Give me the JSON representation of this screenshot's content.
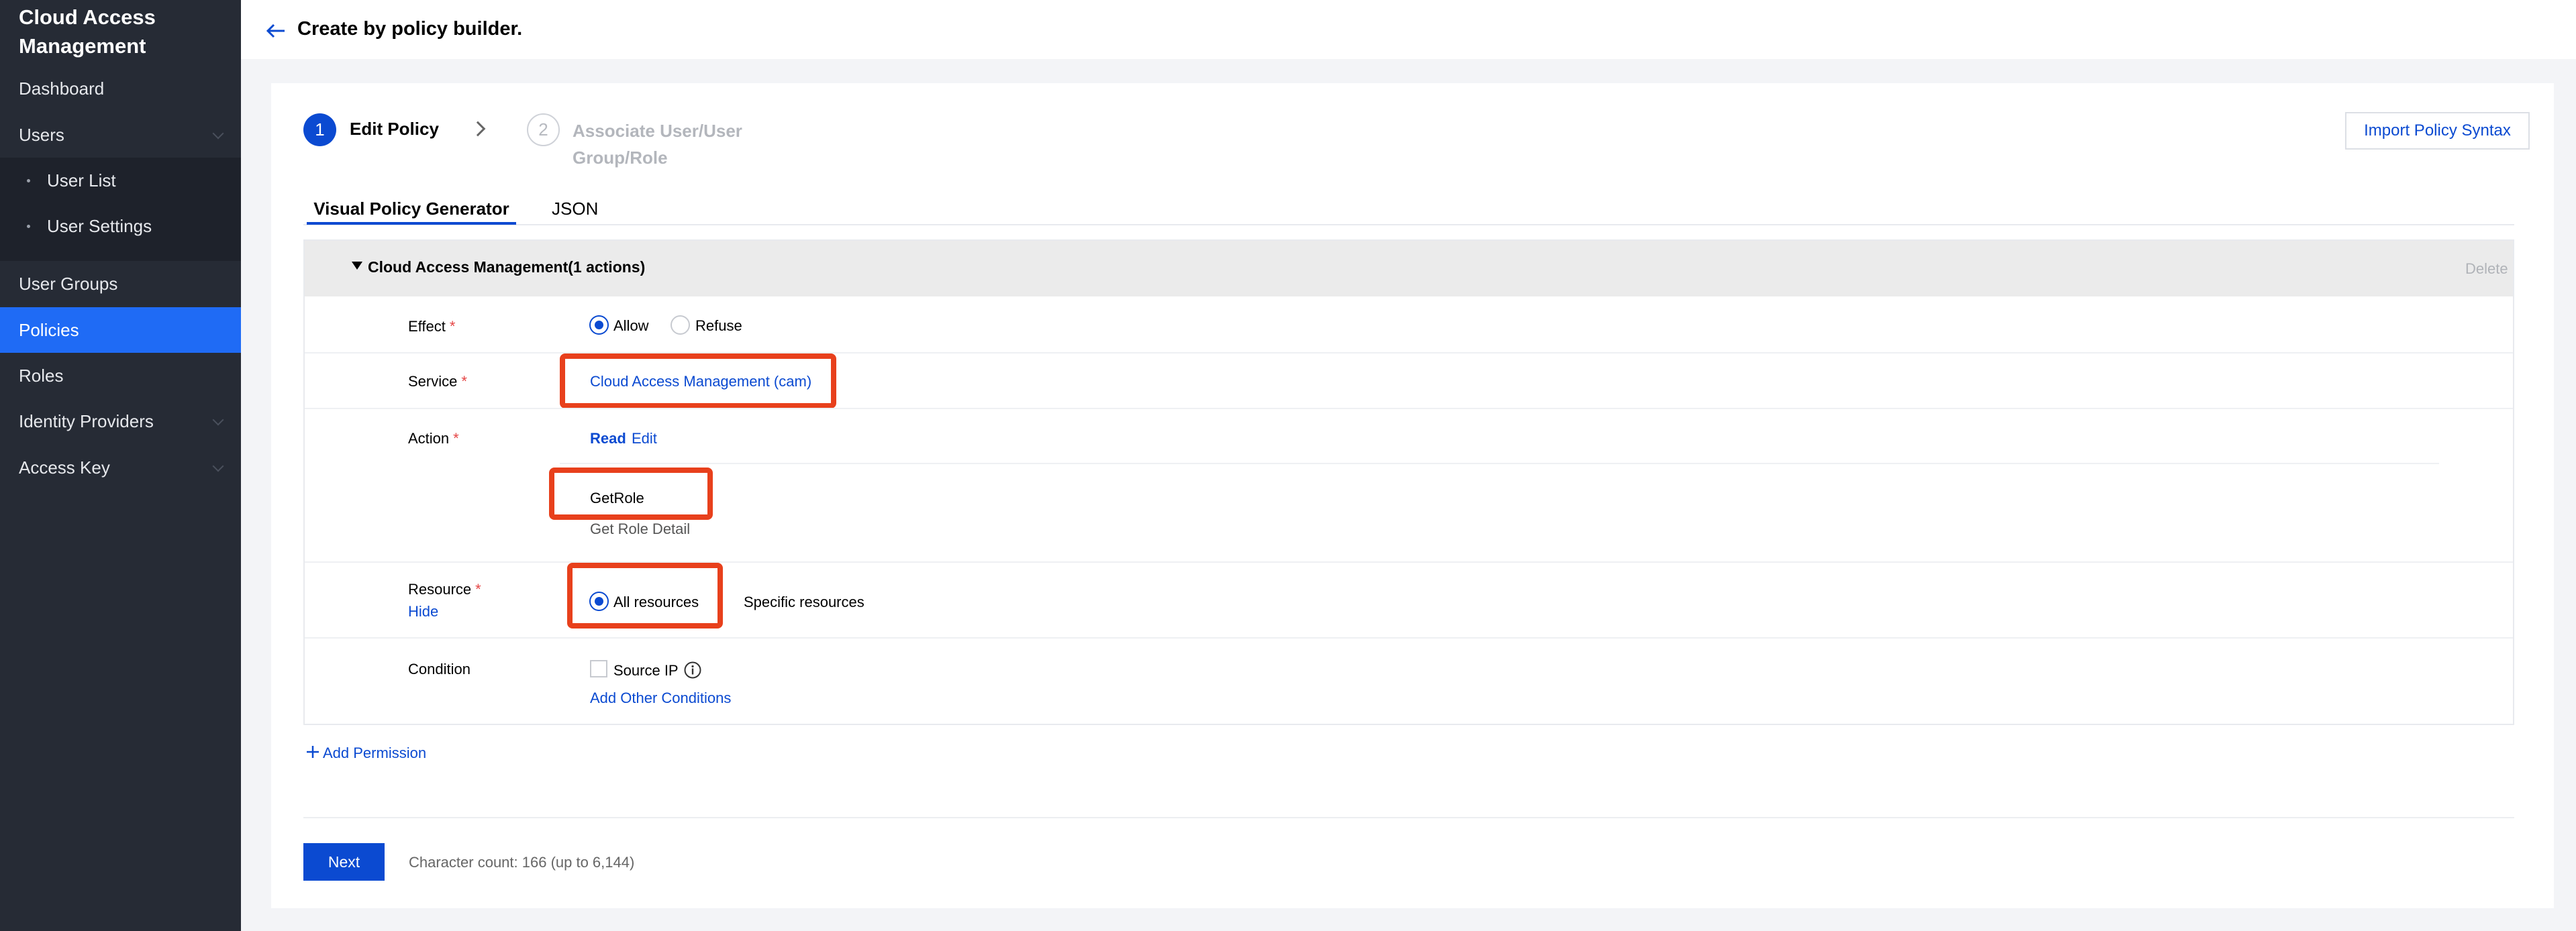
{
  "sidebar": {
    "brand": "Cloud Access Management",
    "items": [
      {
        "label": "Dashboard"
      },
      {
        "label": "Users"
      },
      {
        "label": "User List"
      },
      {
        "label": "User Settings"
      },
      {
        "label": "User Groups"
      },
      {
        "label": "Policies",
        "active": true
      },
      {
        "label": "Roles"
      },
      {
        "label": "Identity Providers"
      },
      {
        "label": "Access Key"
      }
    ]
  },
  "header": {
    "title": "Create by policy builder."
  },
  "steps": [
    {
      "number": "1",
      "label": "Edit Policy"
    },
    {
      "number": "2",
      "label": "Associate User/User Group/Role"
    }
  ],
  "import_button": "Import Policy Syntax",
  "tabs": [
    {
      "label": "Visual Policy Generator",
      "active": true
    },
    {
      "label": "JSON"
    }
  ],
  "permission": {
    "title": "Cloud Access Management(1 actions)",
    "delete": "Delete",
    "effect": {
      "label": "Effect",
      "options": [
        "Allow",
        "Refuse"
      ],
      "selected": "Allow"
    },
    "service": {
      "label": "Service",
      "value": "Cloud Access Management (cam)"
    },
    "action": {
      "label": "Action",
      "categories": [
        "Read",
        "Edit"
      ],
      "name": "GetRole",
      "description": "Get Role Detail"
    },
    "resource": {
      "label": "Resource",
      "toggle": "Hide",
      "options": [
        "All resources",
        "Specific resources"
      ],
      "selected": "All resources"
    },
    "condition": {
      "label": "Condition",
      "checkbox": "Source IP",
      "add": "Add Other Conditions"
    }
  },
  "add_permission": "Add Permission",
  "footer": {
    "next": "Next",
    "char_count": "Character count: 166 (up to 6,144)"
  },
  "colors": {
    "accent": "#0b4ad1",
    "sidebar_bg": "#262b35",
    "active_nav": "#1f6bf5",
    "highlight": "#e8401c"
  }
}
